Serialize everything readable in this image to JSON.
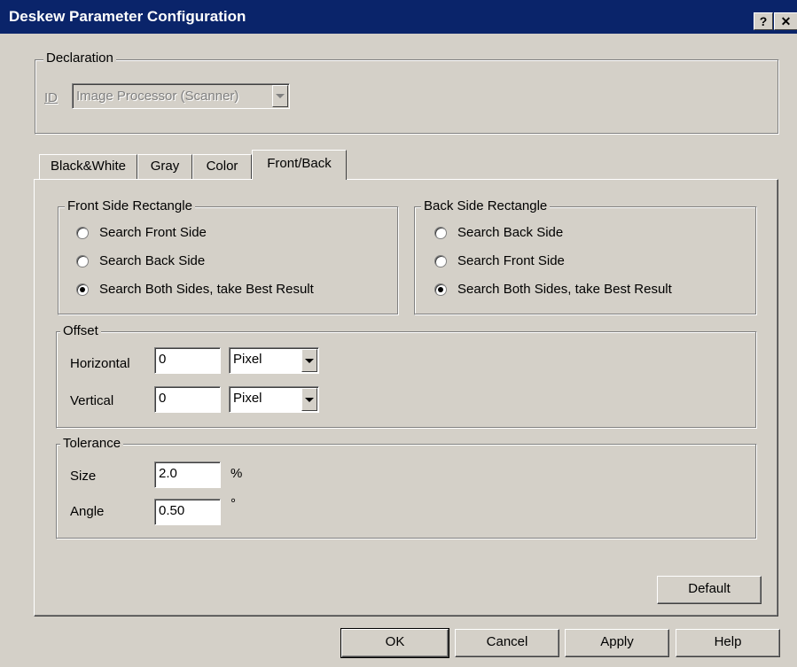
{
  "window": {
    "title": "Deskew Parameter Configuration",
    "help_glyph": "?",
    "close_glyph": "✕"
  },
  "declaration": {
    "group_label": "Declaration",
    "id_label": "ID",
    "id_value": "Image Processor (Scanner)"
  },
  "tabs": [
    {
      "label": "Black&White"
    },
    {
      "label": "Gray"
    },
    {
      "label": "Color"
    },
    {
      "label": "Front/Back"
    }
  ],
  "front_side": {
    "group_label": "Front Side Rectangle",
    "options": [
      {
        "label": "Search Front Side",
        "checked": false
      },
      {
        "label": "Search Back Side",
        "checked": false
      },
      {
        "label": "Search Both Sides, take Best Result",
        "checked": true
      }
    ]
  },
  "back_side": {
    "group_label": "Back Side Rectangle",
    "options": [
      {
        "label": "Search Back Side",
        "checked": false
      },
      {
        "label": "Search Front Side",
        "checked": false
      },
      {
        "label": "Search Both Sides, take Best Result",
        "checked": true
      }
    ]
  },
  "offset": {
    "group_label": "Offset",
    "horizontal_label": "Horizontal",
    "horizontal_value": "0",
    "horizontal_unit": "Pixel",
    "vertical_label": "Vertical",
    "vertical_value": "0",
    "vertical_unit": "Pixel"
  },
  "tolerance": {
    "group_label": "Tolerance",
    "size_label": "Size",
    "size_value": "2.0",
    "size_unit": "%",
    "angle_label": "Angle",
    "angle_value": "0.50",
    "angle_unit": "°"
  },
  "buttons": {
    "default": "Default",
    "ok": "OK",
    "cancel": "Cancel",
    "apply": "Apply",
    "help": "Help"
  }
}
